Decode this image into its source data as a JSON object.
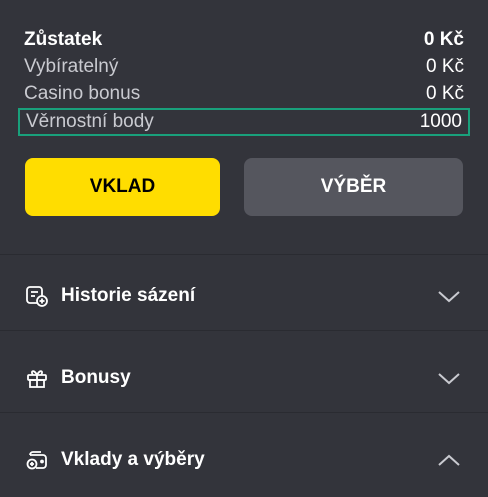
{
  "balance": {
    "rows": [
      {
        "label": "Zůstatek",
        "value": "0 Kč"
      },
      {
        "label": "Vybíratelný",
        "value": "0 Kč"
      },
      {
        "label": "Casino bonus",
        "value": "0 Kč"
      },
      {
        "label": "Věrnostní body",
        "value": "1000"
      }
    ]
  },
  "buttons": {
    "deposit_label": "VKLAD",
    "withdraw_label": "VÝBĚR"
  },
  "sections": [
    {
      "label": "Historie sázení",
      "icon": "bet-history-icon",
      "state": "collapsed"
    },
    {
      "label": "Bonusy",
      "icon": "gift-icon",
      "state": "collapsed"
    },
    {
      "label": "Vklady a výběry",
      "icon": "wallet-coins-icon",
      "state": "expanded"
    }
  ],
  "colors": {
    "background": "#33343b",
    "deposit_button": "#ffdd00",
    "withdraw_button": "#55565e",
    "highlight_border": "#19a07b"
  }
}
